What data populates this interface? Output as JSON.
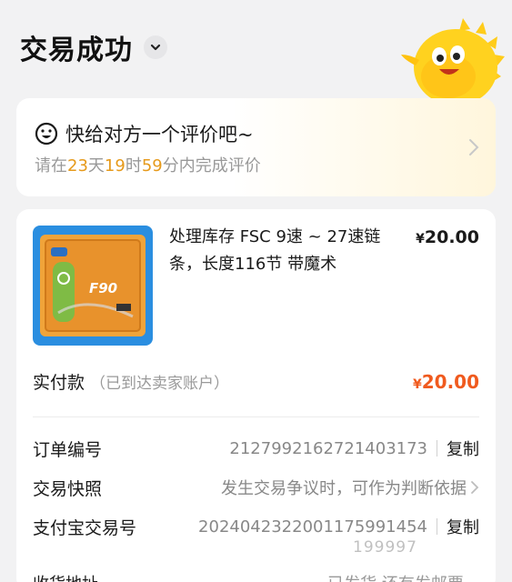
{
  "header": {
    "title": "交易成功"
  },
  "review": {
    "title": "快给对方一个评价吧~",
    "prefix": "请在",
    "days": "23",
    "days_unit": "天",
    "hours": "19",
    "hours_unit": "时",
    "minutes": "59",
    "minutes_unit": "分内完成评价"
  },
  "product": {
    "title": "处理库存 FSC 9速 ~ 27速链条，长度116节 带魔术",
    "price_currency": "¥",
    "price": "20.00",
    "thumb_label": "F90"
  },
  "payment": {
    "label": "实付款",
    "note": "（已到达卖家账户）",
    "currency": "¥",
    "amount": "20.00"
  },
  "details": [
    {
      "label": "订单编号",
      "value": "2127992162721403173",
      "action": "复制"
    },
    {
      "label": "交易快照",
      "value": "发生交易争议时，可作为判断依据"
    },
    {
      "label": "支付宝交易号",
      "value": "2024042322001175991454",
      "action": "复制"
    }
  ],
  "partial_row": {
    "label": "收货地址",
    "value": "已发货 还有发邮票..."
  },
  "watermark": "199997",
  "colors": {
    "accent_orange": "#f05a1e",
    "countdown": "#e69a1b",
    "background": "#f2f2f3"
  }
}
